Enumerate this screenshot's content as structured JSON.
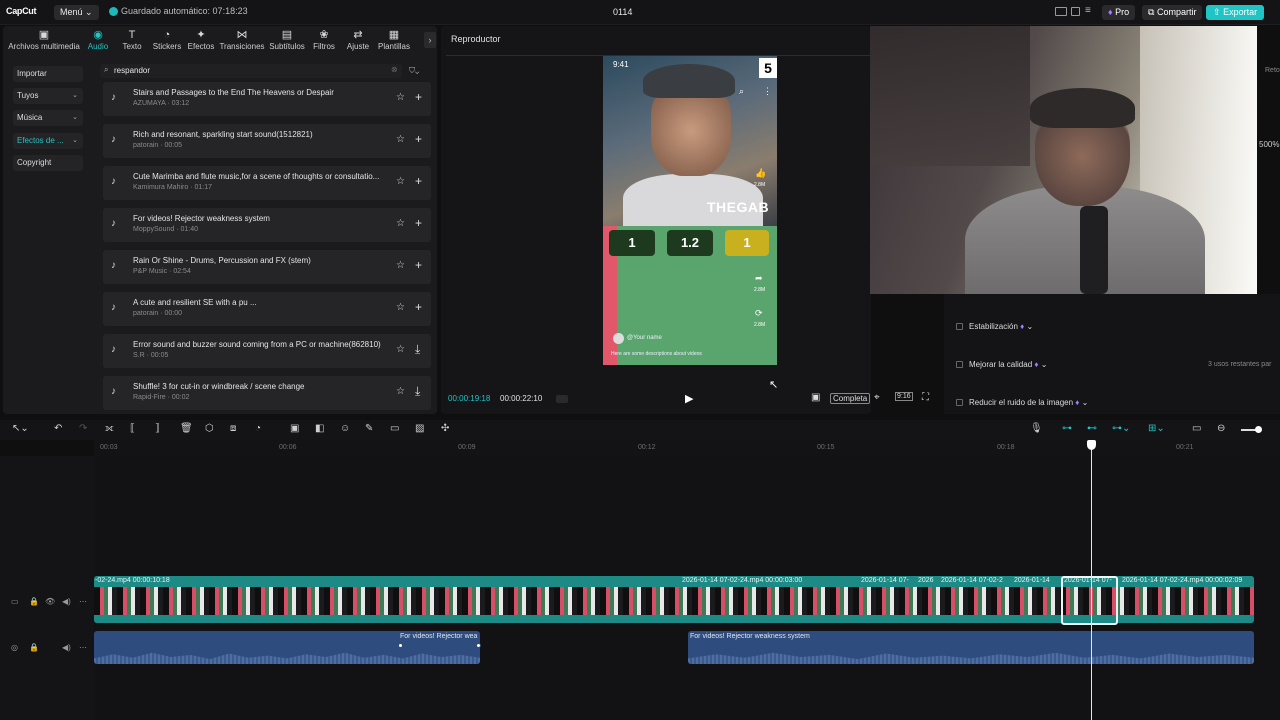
{
  "app": {
    "logo": "CapCut",
    "menu_label": "Menú",
    "autosave": "Guardado automático: 07:18:23",
    "project_name": "0114",
    "pro_label": "Pro",
    "share_label": "Compartir",
    "export_label": "Exportar",
    "accent_color": "#1fc4c4"
  },
  "tabs": [
    {
      "label": "Archivos multimedia",
      "icon": "media-icon"
    },
    {
      "label": "Audio",
      "icon": "audio-icon"
    },
    {
      "label": "Texto",
      "icon": "text-icon"
    },
    {
      "label": "Stickers",
      "icon": "sticker-icon"
    },
    {
      "label": "Efectos",
      "icon": "effects-icon"
    },
    {
      "label": "Transiciones",
      "icon": "transitions-icon"
    },
    {
      "label": "Subtítulos",
      "icon": "subtitles-icon"
    },
    {
      "label": "Filtros",
      "icon": "filters-icon"
    },
    {
      "label": "Ajuste",
      "icon": "adjust-icon"
    },
    {
      "label": "Plantillas",
      "icon": "templates-icon"
    }
  ],
  "sidebar": [
    {
      "label": "Importar"
    },
    {
      "label": "Tuyos"
    },
    {
      "label": "Música"
    },
    {
      "label": "Efectos de ..."
    },
    {
      "label": "Copyright"
    }
  ],
  "search": {
    "value": "respandor"
  },
  "audio_items": [
    {
      "title": "Stairs and Passages to the End The Heavens or Despair",
      "sub": "AZUMAYA · 03:12",
      "action": "+"
    },
    {
      "title": "Rich and resonant, sparkling start sound(1512821)",
      "sub": "patorain · 00:05",
      "action": "+"
    },
    {
      "title": "Cute Marimba and flute music,for a scene of thoughts or consultatio...",
      "sub": "Kamimura Mahiro · 01:17",
      "action": "+"
    },
    {
      "title": "For videos! Rejector weakness system",
      "sub": "MoppySound · 01:40",
      "action": "+"
    },
    {
      "title": "Rain Or Shine - Drums, Percussion and FX (stem)",
      "sub": "P&P Music · 02:54",
      "action": "+"
    },
    {
      "title": "A cute and resilient SE with a pu ...",
      "sub": "patorain · 00:00",
      "action": "+"
    },
    {
      "title": "Error sound and buzzer sound coming from a PC or machine(862810)",
      "sub": "S.R · 00:05",
      "action": "⤓"
    },
    {
      "title": "Shuffle! 3 for cut-in or windbreak / scene change",
      "sub": "Rapid-Fire · 00:02",
      "action": "⤓"
    }
  ],
  "player": {
    "title": "Reproductor",
    "current_time": "00:00:19:18",
    "total_time": "00:00:22:10",
    "completa_label": "Completa",
    "phone_time": "9:41",
    "phone_badge": "5",
    "phone_brand": "THEGAB",
    "scores": [
      "1",
      "1.2",
      "1"
    ],
    "phone_user": "@Your name",
    "phone_desc": "Here are some descriptions about videos",
    "side_counts": [
      "2.8M",
      "2.8M",
      "2.8M",
      "2.8M"
    ]
  },
  "right_panel": {
    "stabilize": "Estabilización",
    "improve": "Mejorar la calidad",
    "usos": "3 usos restantes par",
    "denoise": "Reducir el ruido de la imagen",
    "edge_pct": "500%",
    "edge_reto": "Reto"
  },
  "ruler": [
    "00:03",
    "00:06",
    "00:09",
    "00:12",
    "00:15",
    "00:18",
    "00:21"
  ],
  "video_clips": [
    {
      "label": "-02-24.mp4  00:00:10:18"
    },
    {
      "label": "2026-01-14 07-02-24.mp4  00:00:03:00"
    },
    {
      "label": "2026-01-14 07-"
    },
    {
      "label": "2026"
    },
    {
      "label": "2026-01-14 07-02-2"
    },
    {
      "label": "2026-01-14"
    },
    {
      "label": "2026-01-14 07-"
    },
    {
      "label": "2026-01-14 07-02-24.mp4  00:00:02:09"
    }
  ],
  "audio_clips": [
    {
      "label": "For videos! Rejector wea"
    },
    {
      "label": "For videos! Rejector weakness system"
    }
  ]
}
